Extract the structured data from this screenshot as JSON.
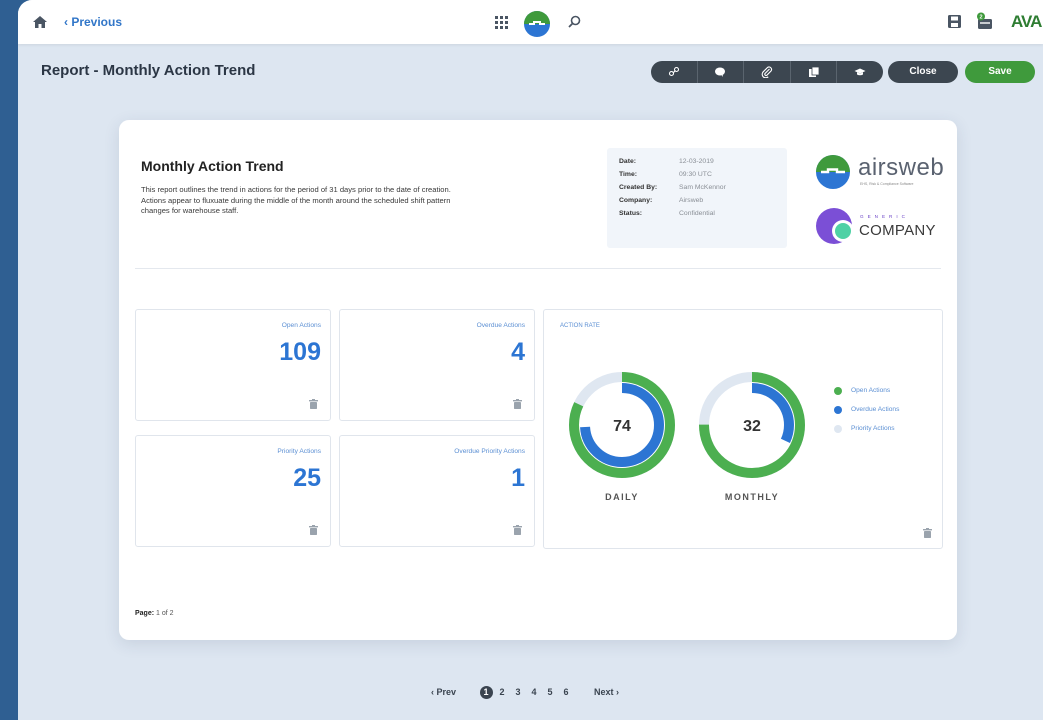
{
  "header": {
    "previous_label": "‹ Previous",
    "ava_logo": "AVA"
  },
  "page": {
    "title": "Report - Monthly Action Trend"
  },
  "toolbar": {
    "tools": [
      "link-icon",
      "comment-icon",
      "attachment-icon",
      "copy-icon",
      "certificate-icon"
    ],
    "close_label": "Close",
    "save_label": "Save"
  },
  "report": {
    "title": "Monthly Action Trend",
    "description": "This report outlines the trend in actions for the period of 31 days prior to the date of creation. Actions appear to fluxuate during the middle of the month around the scheduled shift pattern changes for warehouse staff.",
    "meta": [
      {
        "key": "Date:",
        "value": "12-03-2019"
      },
      {
        "key": "Time:",
        "value": "09:30 UTC"
      },
      {
        "key": "Created By:",
        "value": "Sam McKennor"
      },
      {
        "key": "Company:",
        "value": "Airsweb"
      },
      {
        "key": "Status:",
        "value": "Confidential"
      }
    ],
    "brand1_name": "airsweb",
    "brand1_tag": "EHS, Risk & Compliance Software",
    "brand2_tiny": "GENERIC",
    "brand2_name": "COMPANY"
  },
  "tiles": [
    {
      "label": "Open Actions",
      "value": "109"
    },
    {
      "label": "Overdue Actions",
      "value": "4"
    },
    {
      "label": "Priority Actions",
      "value": "25"
    },
    {
      "label": "Overdue Priority Actions",
      "value": "1"
    }
  ],
  "action_rate": {
    "label": "ACTION RATE",
    "daily": {
      "value": "74",
      "caption": "DAILY",
      "open_fraction": 0.82,
      "overdue_fraction": 0.74
    },
    "monthly": {
      "value": "32",
      "caption": "MONTHLY",
      "open_fraction": 0.75,
      "overdue_fraction": 0.32
    },
    "legend": [
      {
        "label": "Open Actions",
        "color": "#4caf50"
      },
      {
        "label": "Overdue Actions",
        "color": "#2c75d3"
      },
      {
        "label": "Priority Actions",
        "color": "#dfe7f1"
      }
    ]
  },
  "footer": {
    "page_label": "Page:",
    "page_value": "1 of 2"
  },
  "pager": {
    "prev": "‹ Prev",
    "next": "Next ›",
    "pages": [
      "1",
      "2",
      "3",
      "4",
      "5",
      "6"
    ],
    "active": "1"
  }
}
